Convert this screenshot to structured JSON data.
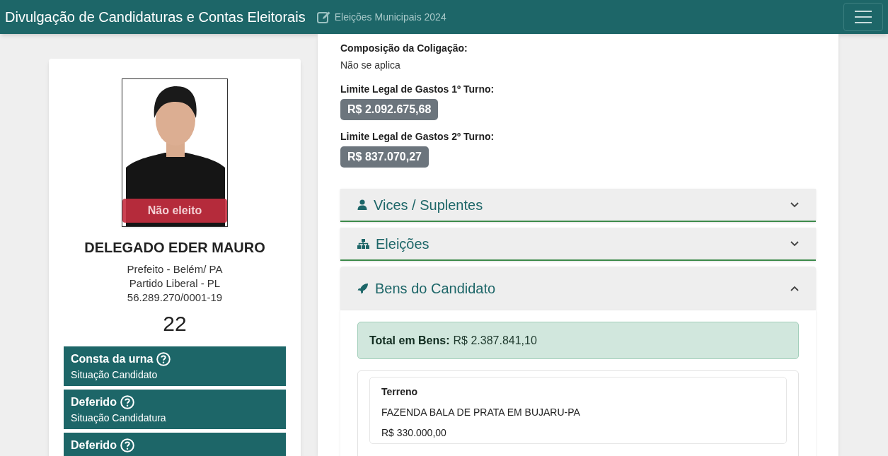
{
  "header": {
    "title": "Divulgação de Candidaturas e Contas Eleitorais",
    "election": "Eleições Municipais 2024"
  },
  "candidate": {
    "result_badge": "Não eleito",
    "name": "DELEGADO EDER MAURO",
    "details": [
      "Prefeito - Belém/ PA",
      "Partido Liberal - PL",
      "56.289.270/0001-19"
    ],
    "number": "22",
    "status_boxes": [
      {
        "value": "Consta da urna",
        "label": "Situação Candidato"
      },
      {
        "value": "Deferido",
        "label": "Situação Candidatura"
      },
      {
        "value": "Deferido"
      }
    ]
  },
  "info": [
    {
      "label": "Composição da Coligação:",
      "value": "Não se aplica",
      "kind": "text"
    },
    {
      "label": "Limite Legal de Gastos 1º Turno:",
      "value": "R$ 2.092.675,68",
      "kind": "badge"
    },
    {
      "label": "Limite Legal de Gastos 2º Turno:",
      "value": "R$ 837.070,27",
      "kind": "badge"
    }
  ],
  "sections": [
    {
      "title": "Vices / Suplentes",
      "kind": "person",
      "expanded": false
    },
    {
      "title": "Eleições",
      "kind": "sitemap",
      "expanded": false
    },
    {
      "title": "Bens do Candidato",
      "kind": "rocket",
      "expanded": true
    }
  ],
  "assets": {
    "total_label": "Total em Bens:",
    "total_value": "R$ 2.387.841,10",
    "items": [
      {
        "type": "Terreno",
        "description": "FAZENDA BALA DE PRATA EM BUJARU-PA",
        "value": "R$ 330.000,00"
      }
    ]
  }
}
